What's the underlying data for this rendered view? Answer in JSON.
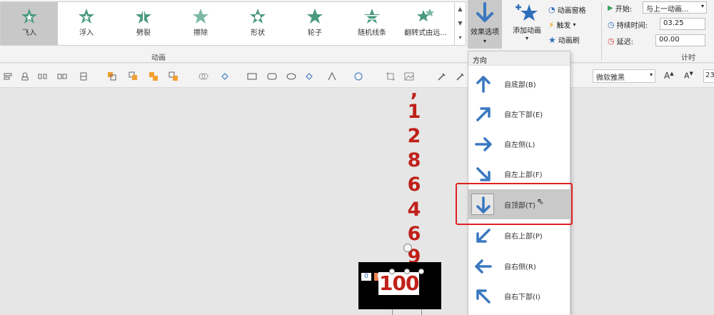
{
  "ribbon": {
    "animations": [
      {
        "label": "飞入",
        "icon": "star-fly-in-icon",
        "selected": true
      },
      {
        "label": "浮入",
        "icon": "star-float-in-icon"
      },
      {
        "label": "劈裂",
        "icon": "star-split-icon"
      },
      {
        "label": "擦除",
        "icon": "star-wipe-icon"
      },
      {
        "label": "形状",
        "icon": "star-shape-icon"
      },
      {
        "label": "轮子",
        "icon": "star-wheel-icon"
      },
      {
        "label": "随机线条",
        "icon": "star-random-bars-icon"
      },
      {
        "label": "翻转式由远...",
        "icon": "star-grow-turn-icon"
      }
    ],
    "animation_group_label": "动画",
    "effect_options_label": "效果选项",
    "add_animation_label": "添加动画",
    "animation_pane_label": "动画窗格",
    "trigger_label": "触发",
    "animation_painter_label": "动画刷",
    "timing": {
      "start_label": "开始:",
      "start_value": "与上一动画...",
      "duration_label": "持续时间:",
      "duration_value": "03.25",
      "delay_label": "延迟:",
      "delay_value": "00.00",
      "group_label": "计时"
    }
  },
  "toolbar": {
    "font_name": "微软雅黑",
    "font_size": "23"
  },
  "dropdown": {
    "header": "方向",
    "items": [
      {
        "label": "自底部(B)",
        "icon": "arrow-up-icon"
      },
      {
        "label": "自左下部(E)",
        "icon": "arrow-up-right-icon"
      },
      {
        "label": "自左侧(L)",
        "icon": "arrow-right-icon"
      },
      {
        "label": "自左上部(F)",
        "icon": "arrow-down-right-icon"
      },
      {
        "label": "自顶部(T)",
        "icon": "arrow-down-icon",
        "active": true
      },
      {
        "label": "自右上部(P)",
        "icon": "arrow-down-left-icon"
      },
      {
        "label": "自右侧(R)",
        "icon": "arrow-left-icon"
      },
      {
        "label": "自右下部(I)",
        "icon": "arrow-up-left-icon"
      }
    ]
  },
  "canvas": {
    "digit_column": [
      ",",
      "1",
      "2",
      "8",
      "6",
      "4",
      "6",
      "9"
    ],
    "small_digits": [
      "0",
      "0"
    ],
    "big_digits": "100"
  },
  "colors": {
    "accent_arrow": "#3a78c0",
    "digit_red": "#c0201a",
    "highlight": "#e02020",
    "star_green": "#4a9a80"
  }
}
